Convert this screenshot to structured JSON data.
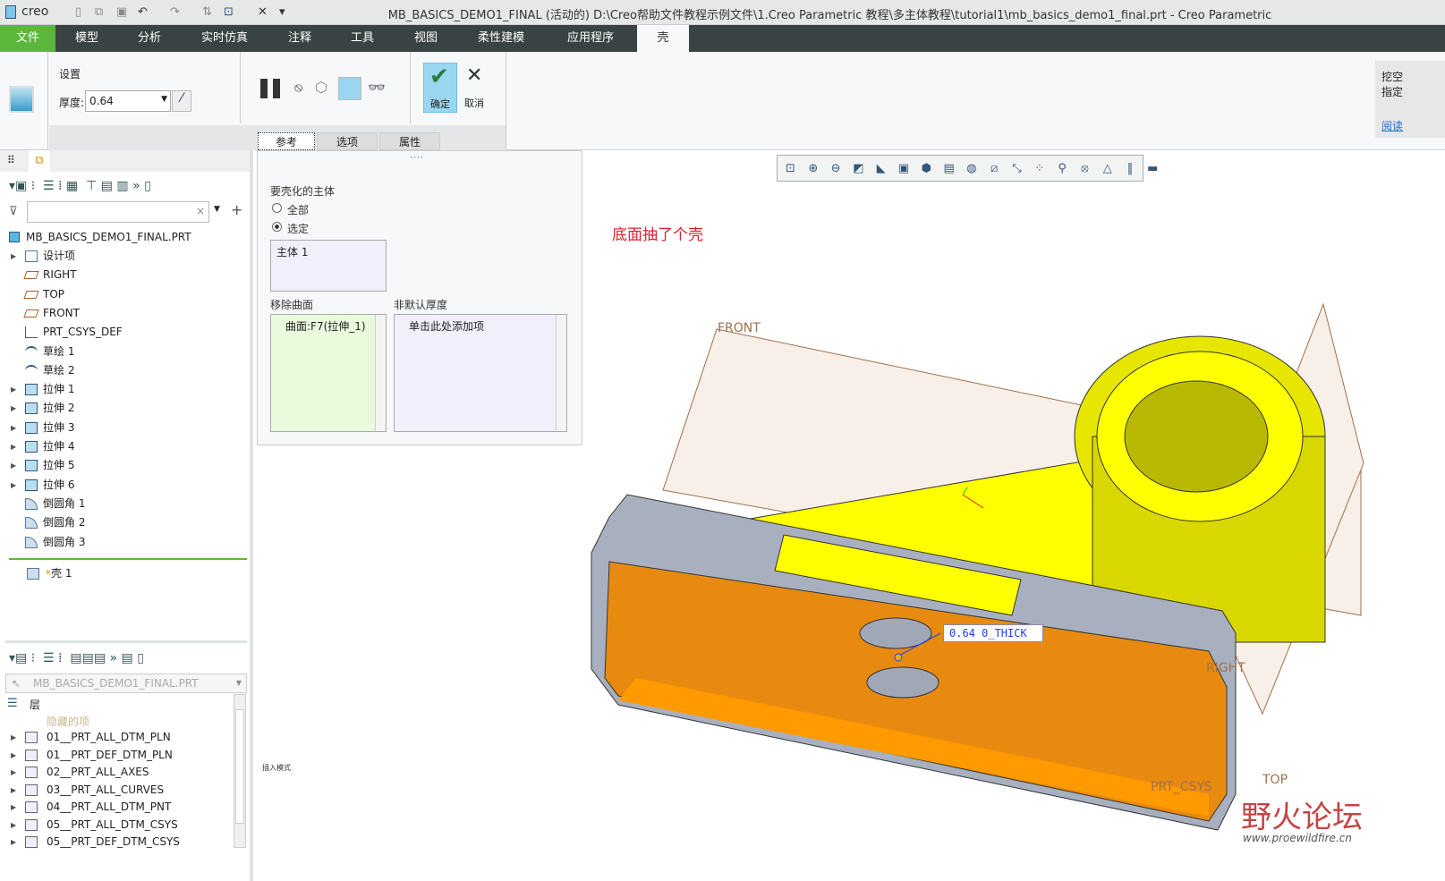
{
  "app": {
    "logo": "creo",
    "title": "MB_BASICS_DEMO1_FINAL (活动的) D:\\Creo帮助文件教程示例文件\\1.Creo Parametric 教程\\多主体教程\\tutorial1\\mb_basics_demo1_final.prt - Creo Parametric"
  },
  "menu": [
    {
      "label": "文件"
    },
    {
      "label": "模型"
    },
    {
      "label": "分析"
    },
    {
      "label": "实时仿真"
    },
    {
      "label": "注释"
    },
    {
      "label": "工具"
    },
    {
      "label": "视图"
    },
    {
      "label": "柔性建模"
    },
    {
      "label": "应用程序"
    },
    {
      "label": "壳"
    }
  ],
  "ribbon": {
    "settings_label": "设置",
    "thickness_label": "厚度:",
    "thickness_value": "0.64",
    "ok_label": "确定",
    "cancel_label": "取消",
    "side_text1": "挖空",
    "side_text2": "指定",
    "side_link": "阅读"
  },
  "subtabs": [
    {
      "label": "参考"
    },
    {
      "label": "选项"
    },
    {
      "label": "属性"
    }
  ],
  "panel": {
    "bodies_title": "要壳化的主体",
    "radio_all": "全部",
    "radio_selected": "选定",
    "bodies_item": "主体 1",
    "remove_title": "移除曲面",
    "remove_item": "曲面:F7(拉伸_1)",
    "nondefault_title": "非默认厚度",
    "nondefault_item": "单击此处添加项"
  },
  "tree": {
    "root": "MB_BASICS_DEMO1_FINAL.PRT",
    "items": [
      {
        "label": "设计项",
        "icon": "design-items-icon",
        "exp": true
      },
      {
        "label": "RIGHT",
        "icon": "datum-plane-icon"
      },
      {
        "label": "TOP",
        "icon": "datum-plane-icon"
      },
      {
        "label": "FRONT",
        "icon": "datum-plane-icon"
      },
      {
        "label": "PRT_CSYS_DEF",
        "icon": "csys-icon"
      },
      {
        "label": "草绘 1",
        "icon": "sketch-icon"
      },
      {
        "label": "草绘 2",
        "icon": "sketch-icon"
      },
      {
        "label": "拉伸 1",
        "icon": "extrude-icon",
        "exp": true
      },
      {
        "label": "拉伸 2",
        "icon": "extrude-icon",
        "exp": true
      },
      {
        "label": "拉伸 3",
        "icon": "extrude-icon",
        "exp": true
      },
      {
        "label": "拉伸 4",
        "icon": "extrude-icon",
        "exp": true
      },
      {
        "label": "拉伸 5",
        "icon": "extrude-icon",
        "exp": true
      },
      {
        "label": "拉伸 6",
        "icon": "extrude-icon",
        "exp": true
      },
      {
        "label": "倒圆角 1",
        "icon": "round-icon"
      },
      {
        "label": "倒圆角 2",
        "icon": "round-icon"
      },
      {
        "label": "倒圆角 3",
        "icon": "round-icon"
      }
    ],
    "insert_item": "壳 1"
  },
  "layers": {
    "model": "MB_BASICS_DEMO1_FINAL.PRT",
    "header": "层",
    "hidden": "隐藏的项",
    "items": [
      {
        "label": "01__PRT_ALL_DTM_PLN"
      },
      {
        "label": "01__PRT_DEF_DTM_PLN"
      },
      {
        "label": "02__PRT_ALL_AXES"
      },
      {
        "label": "03__PRT_ALL_CURVES"
      },
      {
        "label": "04__PRT_ALL_DTM_PNT"
      },
      {
        "label": "05__PRT_ALL_DTM_CSYS"
      },
      {
        "label": "05__PRT_DEF_DTM_CSYS"
      }
    ]
  },
  "status": "插入模式",
  "viewport": {
    "annotation": "底面抽了个壳",
    "dim": "0.64 0_THICK",
    "front": "FRONT",
    "right": "RIGHT",
    "top": "TOP",
    "csys": "PRT_CSYS",
    "watermark": "野火论坛",
    "watermark_url": "www.proewildfire.cn"
  },
  "colors": {
    "accent": "#5bb73b",
    "menubar": "#3a4343",
    "part": "#ffff00",
    "shell": "#ff9900",
    "annotation": "#e0202a"
  }
}
